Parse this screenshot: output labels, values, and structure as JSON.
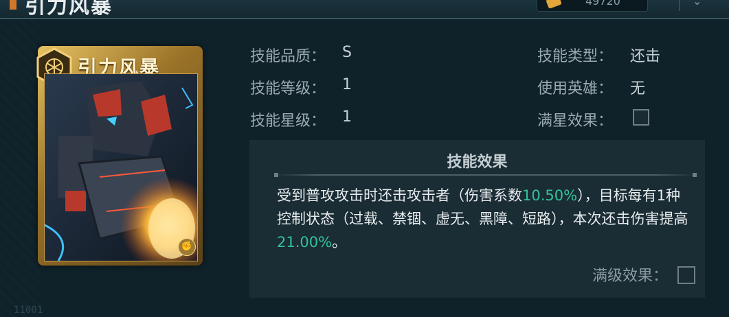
{
  "header": {
    "title": "引力风暴",
    "currency_value": "49720"
  },
  "card": {
    "name": "引力风暴",
    "type_badge": "fist-icon"
  },
  "info": {
    "quality_label": "技能品质：",
    "quality_value": "S",
    "level_label": "技能等级：",
    "level_value": "1",
    "star_label": "技能星级：",
    "star_value": "1",
    "type_label": "技能类型：",
    "type_value": "还击",
    "hero_label": "使用英雄：",
    "hero_value": "无",
    "full_star_label": "满星效果："
  },
  "effect": {
    "title": "技能效果",
    "desc_part1": "受到普攻攻击时还击攻击者（伤害系数",
    "coef": "10.50%",
    "desc_part2": "），目标每有1种控制状态（过载、禁锢、虚无、黑障、短路），本次还击伤害提高",
    "bonus": "21.00%",
    "desc_part3": "。",
    "max_level_label": "满级效果："
  },
  "footer": {
    "code": "11001"
  },
  "colors": {
    "highlight": "#33c39a",
    "card_gold": "#c9a24c"
  }
}
